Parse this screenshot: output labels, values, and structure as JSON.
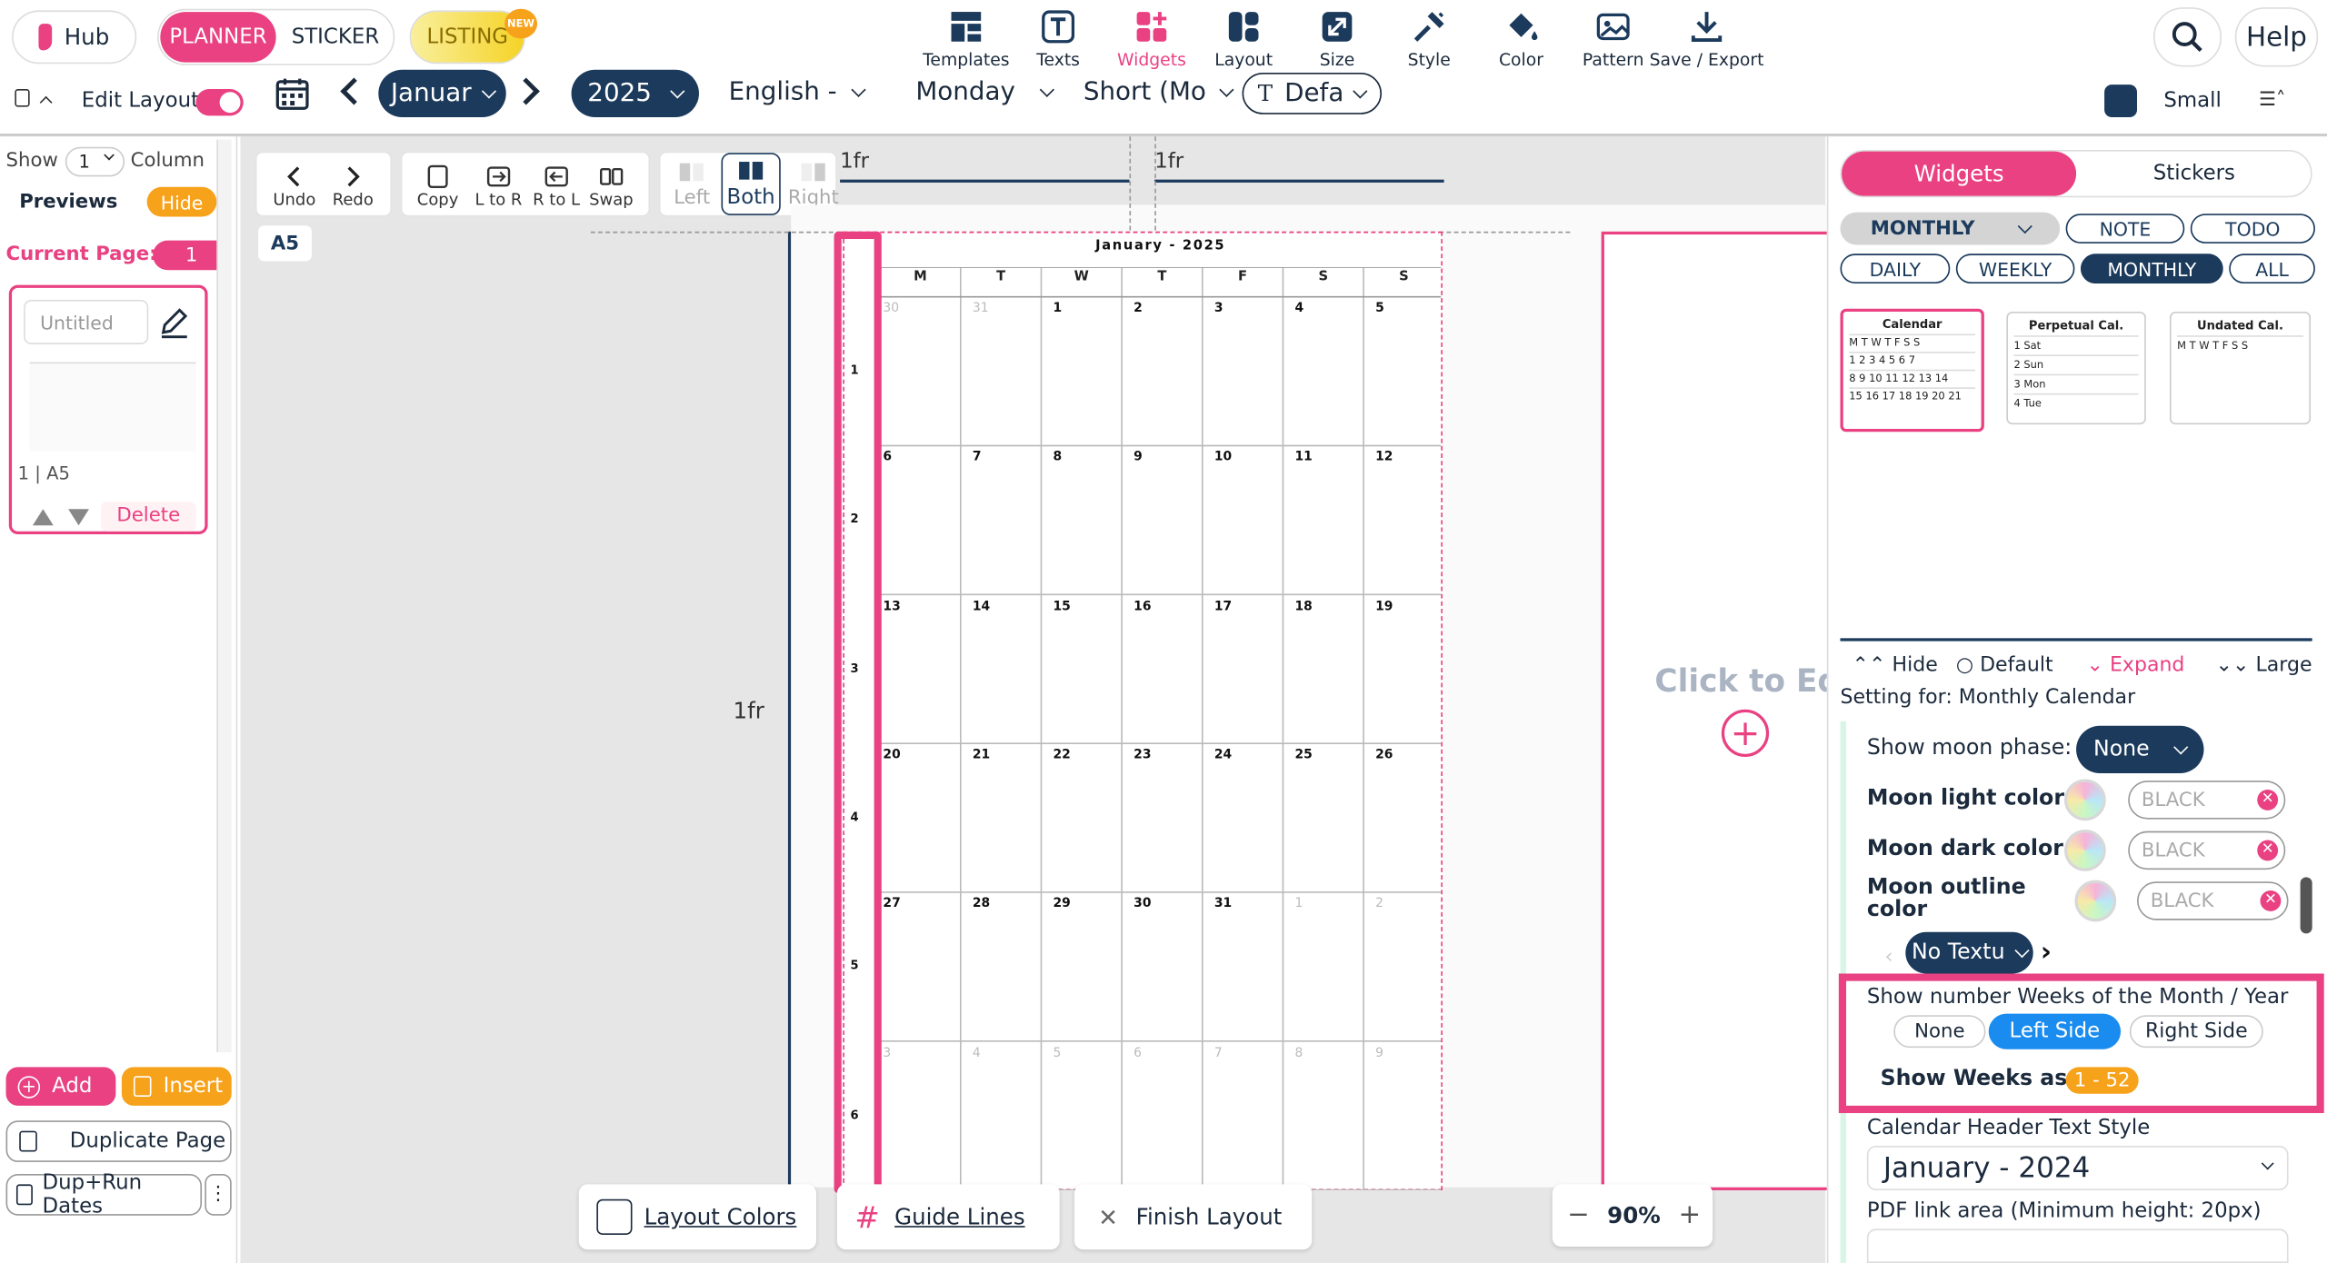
{
  "header": {
    "hub_label": "Hub",
    "planner_label": "PLANNER",
    "sticker_label": "STICKER",
    "listing_label": "LISTING",
    "new_badge": "NEW",
    "tools": [
      {
        "label": "Templates",
        "icon": "templates-icon"
      },
      {
        "label": "Texts",
        "icon": "text-icon"
      },
      {
        "label": "Widgets",
        "icon": "widgets-icon"
      },
      {
        "label": "Layout",
        "icon": "layout-icon"
      },
      {
        "label": "Size",
        "icon": "resize-icon"
      },
      {
        "label": "Style",
        "icon": "style-icon"
      },
      {
        "label": "Color",
        "icon": "color-bucket-icon"
      },
      {
        "label": "Pattern",
        "icon": "pattern-icon"
      },
      {
        "label": "Save / Export",
        "icon": "download-icon"
      }
    ],
    "help_label": "Help"
  },
  "subbar": {
    "edit_layout_label": "Edit Layout",
    "month": "Januar",
    "year": "2025",
    "language": "English - E",
    "week_start": "Monday",
    "day_format": "Short (Mo",
    "font": "Defa",
    "size_label": "Small"
  },
  "left_panel": {
    "show_label": "Show",
    "show_value": "1",
    "column_label": "Column",
    "previews_label": "Previews",
    "hide_label": "Hide",
    "current_page_label": "Current Page:",
    "current_page_value": "1",
    "page_title_placeholder": "Untitled",
    "page_caption": "1 | A5",
    "delete_label": "Delete",
    "add_label": "Add",
    "insert_label": "Insert",
    "duplicate_label": "Duplicate Page",
    "dup_run_label": "Dup+Run Dates"
  },
  "toolbar": {
    "undo": "Undo",
    "redo": "Redo",
    "copy": "Copy",
    "l_to_r": "L to R",
    "r_to_l": "R to L",
    "swap": "Swap",
    "left": "Left",
    "both": "Both",
    "right": "Right",
    "page_size": "A5"
  },
  "canvas": {
    "fr_top_1": "1fr",
    "fr_top_2": "1fr",
    "fr_left": "1fr",
    "calendar_title": "January - 2025",
    "weekdays": [
      "M",
      "T",
      "W",
      "T",
      "F",
      "S",
      "S"
    ],
    "weeks": [
      {
        "num": "1",
        "days": [
          "30",
          "31",
          "1",
          "2",
          "3",
          "4",
          "5"
        ],
        "dim": [
          true,
          true,
          false,
          false,
          false,
          false,
          false
        ]
      },
      {
        "num": "2",
        "days": [
          "6",
          "7",
          "8",
          "9",
          "10",
          "11",
          "12"
        ],
        "dim": [
          false,
          false,
          false,
          false,
          false,
          false,
          false
        ]
      },
      {
        "num": "3",
        "days": [
          "13",
          "14",
          "15",
          "16",
          "17",
          "18",
          "19"
        ],
        "dim": [
          false,
          false,
          false,
          false,
          false,
          false,
          false
        ]
      },
      {
        "num": "4",
        "days": [
          "20",
          "21",
          "22",
          "23",
          "24",
          "25",
          "26"
        ],
        "dim": [
          false,
          false,
          false,
          false,
          false,
          false,
          false
        ]
      },
      {
        "num": "5",
        "days": [
          "27",
          "28",
          "29",
          "30",
          "31",
          "1",
          "2"
        ],
        "dim": [
          false,
          false,
          false,
          false,
          false,
          true,
          true
        ]
      },
      {
        "num": "6",
        "days": [
          "3",
          "4",
          "5",
          "6",
          "7",
          "8",
          "9"
        ],
        "dim": [
          true,
          true,
          true,
          true,
          true,
          true,
          true
        ]
      }
    ],
    "click_to_edit": "Click to Edi",
    "zoom": "90%"
  },
  "bottom_bar": {
    "layout_colors": "Layout Colors",
    "guide_lines": "Guide Lines",
    "finish_layout": "Finish Layout"
  },
  "right_panel": {
    "tab_widgets": "Widgets",
    "tab_stickers": "Stickers",
    "filter_select": "MONTHLY",
    "chips_row1": [
      "NOTE",
      "TODO"
    ],
    "chips_row2": [
      "DAILY",
      "WEEKLY",
      "MONTHLY",
      "ALL"
    ],
    "widget_cards": [
      {
        "title": "Calendar",
        "rows": [
          "M T W T F S S",
          "1 2 3 4 5 6 7",
          "8 9 10 11 12 13 14",
          "15 16 17 18 19 20 21"
        ]
      },
      {
        "title": "Perpetual Cal.",
        "rows": [
          "1 Sat",
          "2 Sun",
          "3 Mon",
          "4 Tue"
        ]
      },
      {
        "title": "Undated Cal.",
        "rows": [
          "M T W T F S S"
        ]
      }
    ],
    "size_options": [
      "Hide",
      "Default",
      "Expand",
      "Large"
    ],
    "setting_for": "Setting for: Monthly Calendar",
    "moon_phase_label": "Show moon phase:",
    "moon_phase_value": "None",
    "moon_light_label": "Moon light color",
    "moon_dark_label": "Moon dark color",
    "moon_outline_label": "Moon outline color",
    "color_placeholder": "BLACK",
    "no_texture": "No Textu",
    "weeks_label": "Show number Weeks of the Month / Year",
    "weeks_options": [
      "None",
      "Left Side",
      "Right Side"
    ],
    "show_weeks_as_label": "Show Weeks as",
    "show_weeks_as_value": "1 - 52",
    "header_style_label": "Calendar Header Text Style",
    "header_style_value": "January - 2024",
    "pdf_link_label": "PDF link area (Minimum height: 20px)"
  },
  "colors": {
    "pink": "#e94182",
    "navy": "#1b3a5c",
    "blue": "#1a8cf0",
    "orange": "#f7a21b"
  }
}
